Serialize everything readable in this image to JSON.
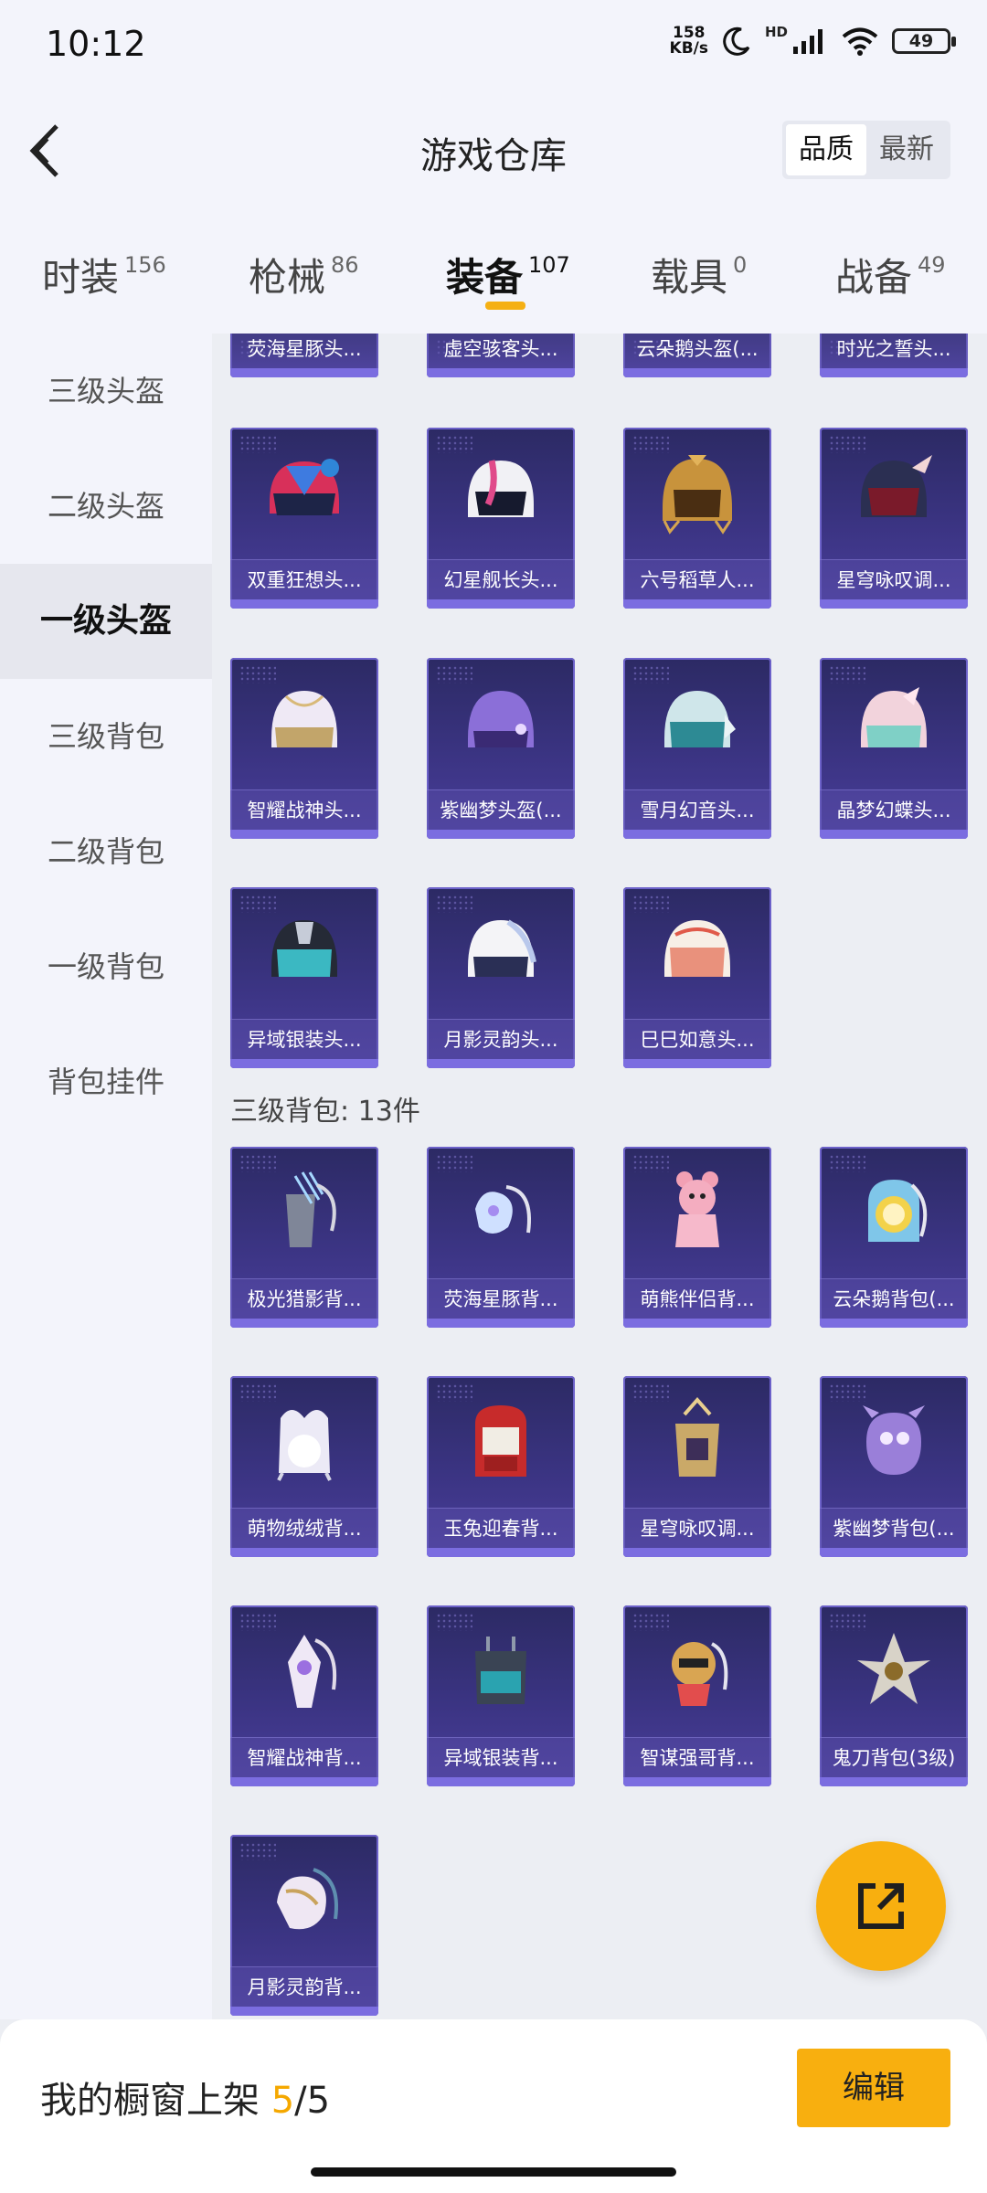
{
  "status": {
    "time": "10:12",
    "net_speed": "158",
    "net_unit": "KB/s",
    "hd": "HD",
    "battery": "49"
  },
  "header": {
    "title": "游戏仓库",
    "sort_options": [
      "品质",
      "最新"
    ]
  },
  "tabs": [
    {
      "label": "时装",
      "count": "156"
    },
    {
      "label": "枪械",
      "count": "86"
    },
    {
      "label": "装备",
      "count": "107"
    },
    {
      "label": "载具",
      "count": "0"
    },
    {
      "label": "战备",
      "count": "49"
    }
  ],
  "sidebar": [
    {
      "label": "三级头盔"
    },
    {
      "label": "二级头盔"
    },
    {
      "label": "一级头盔"
    },
    {
      "label": "三级背包"
    },
    {
      "label": "二级背包"
    },
    {
      "label": "一级背包"
    },
    {
      "label": "背包挂件"
    }
  ],
  "colors": {
    "accent": "#f8af0f",
    "card_bg": "#3b3483",
    "card_border": "#6c61c9"
  },
  "partial_row": [
    "荧海星豚头...",
    "虚空骇客头...",
    "云朵鹅头盔(...",
    "时光之誓头..."
  ],
  "helmets": [
    {
      "name": "双重狂想头...",
      "icon": "helmet-pink-blue"
    },
    {
      "name": "幻星舰长头...",
      "icon": "helmet-white-pink"
    },
    {
      "name": "六号稻草人...",
      "icon": "helmet-straw"
    },
    {
      "name": "星穹咏叹调...",
      "icon": "helmet-dark-wing"
    },
    {
      "name": "智耀战神头...",
      "icon": "helmet-white-gold"
    },
    {
      "name": "紫幽梦头盔(...",
      "icon": "helmet-purple"
    },
    {
      "name": "雪月幻音头...",
      "icon": "helmet-teal"
    },
    {
      "name": "晶梦幻蝶头...",
      "icon": "helmet-pink-mint"
    },
    {
      "name": "异域银装头...",
      "icon": "helmet-black-teal"
    },
    {
      "name": "月影灵韵头...",
      "icon": "helmet-white"
    },
    {
      "name": "巳巳如意头...",
      "icon": "helmet-peach"
    }
  ],
  "backpack_section": {
    "title": "三级背包: 13件"
  },
  "backpacks": [
    {
      "name": "极光猎影背...",
      "icon": "backpack-quiver"
    },
    {
      "name": "荧海星豚背...",
      "icon": "backpack-dolphin"
    },
    {
      "name": "萌熊伴侣背...",
      "icon": "backpack-bear"
    },
    {
      "name": "云朵鹅背包(...",
      "icon": "backpack-goose"
    },
    {
      "name": "萌物绒绒背...",
      "icon": "backpack-plush"
    },
    {
      "name": "玉兔迎春背...",
      "icon": "backpack-red"
    },
    {
      "name": "星穹咏叹调...",
      "icon": "backpack-gold"
    },
    {
      "name": "紫幽梦背包(...",
      "icon": "backpack-purple"
    },
    {
      "name": "智耀战神背...",
      "icon": "backpack-knight"
    },
    {
      "name": "异域银装背...",
      "icon": "backpack-tactical"
    },
    {
      "name": "智谋强哥背...",
      "icon": "backpack-critter"
    },
    {
      "name": "鬼刀背包(3级)",
      "icon": "backpack-blade"
    },
    {
      "name": "月影灵韵背...",
      "icon": "backpack-moon"
    }
  ],
  "bottom": {
    "shelf_label": "我的橱窗上架",
    "shelf_current": "5",
    "shelf_sep": "/",
    "shelf_total": "5",
    "edit_label": "编辑"
  }
}
